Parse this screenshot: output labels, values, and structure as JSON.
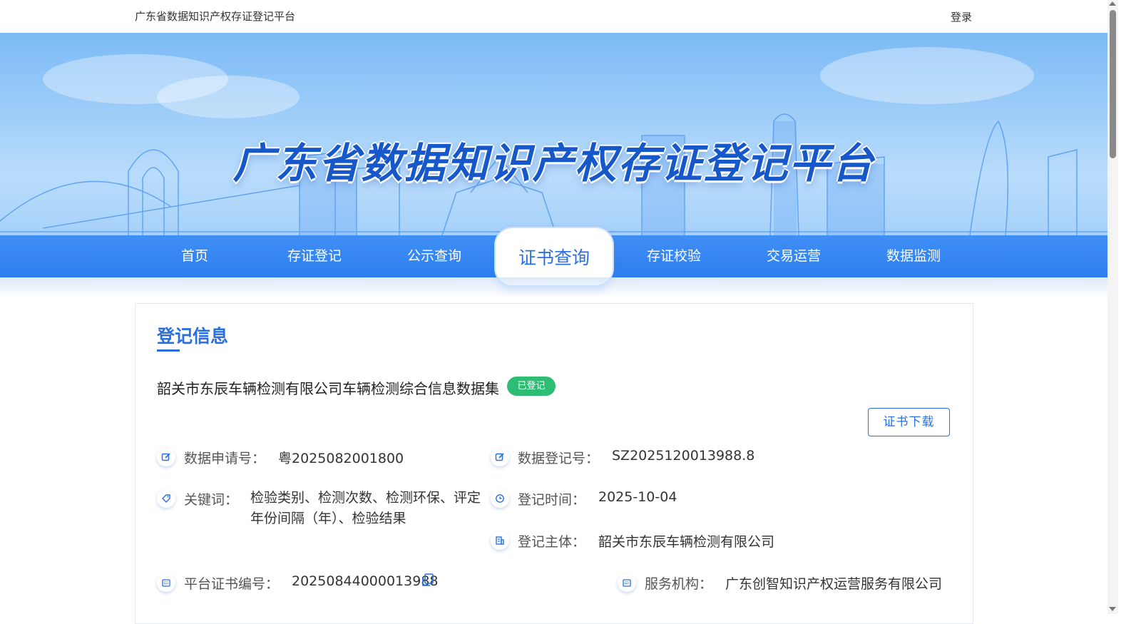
{
  "topbar": {
    "site_name": "广东省数据知识产权存证登记平台",
    "login_label": "登录"
  },
  "banner": {
    "title": "广东省数据知识产权存证登记平台"
  },
  "nav": {
    "items": [
      {
        "label": "首页"
      },
      {
        "label": "存证登记"
      },
      {
        "label": "公示查询"
      },
      {
        "label": "证书查询"
      },
      {
        "label": "存证校验"
      },
      {
        "label": "交易运营"
      },
      {
        "label": "数据监测"
      }
    ],
    "active_index": 3
  },
  "card": {
    "title": "登记信息",
    "dataset_name": "韶关市东辰车辆检测有限公司车辆检测综合信息数据集",
    "status_badge": "已登记",
    "download_label": "证书下载",
    "fields": {
      "application_no": {
        "label": "数据申请号：",
        "value": "粤2025082001800",
        "icon": "edit-icon"
      },
      "registration_no": {
        "label": "数据登记号：",
        "value": "SZ2025120013988.8",
        "icon": "edit-icon"
      },
      "keywords": {
        "label": "关键词：",
        "value": "检验类别、检测次数、检测环保、评定年份间隔（年）、检验结果",
        "icon": "tag-icon"
      },
      "registration_time": {
        "label": "登记时间：",
        "value": "2025-10-04",
        "icon": "clock-icon"
      },
      "registrant": {
        "label": "登记主体：",
        "value": "韶关市东辰车辆检测有限公司",
        "icon": "entity-icon"
      },
      "platform_cert_no": {
        "label": "平台证书编号：",
        "value": "20250844000013988",
        "icon": "calendar-icon"
      },
      "service_org": {
        "label": "服务机构：",
        "value": "广东创智知识产权运营服务有限公司",
        "icon": "calendar-icon"
      }
    }
  },
  "colors": {
    "primary": "#2a6fe0",
    "nav_bg": "#3f8ff5",
    "badge_green": "#2dbd74"
  }
}
